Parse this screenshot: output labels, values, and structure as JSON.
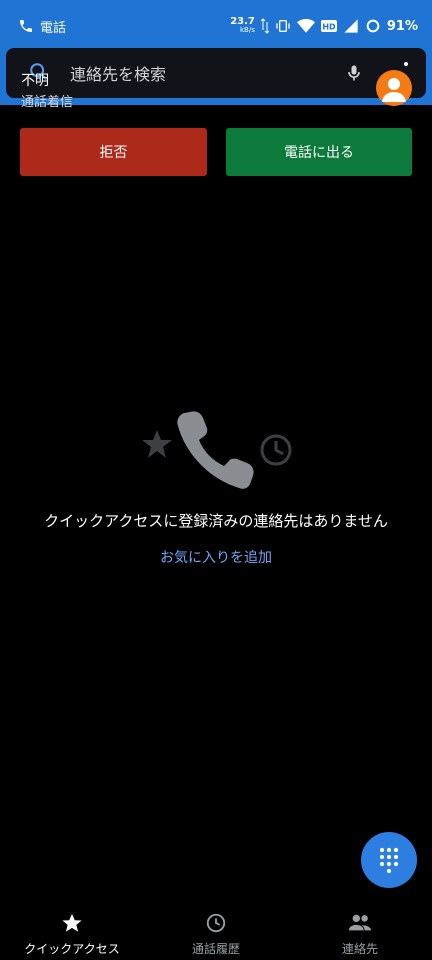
{
  "status_bar": {
    "app_label": "電話",
    "net_speed_value": "23.7",
    "net_speed_unit": "kB/s",
    "battery_percent": "91%"
  },
  "search": {
    "placeholder": "連絡先を検索"
  },
  "incoming_call": {
    "caller_name": "不明",
    "status_text": "通話着信",
    "decline_label": "拒否",
    "answer_label": "電話に出る"
  },
  "empty_state": {
    "message": "クイックアクセスに登録済みの連絡先はありません",
    "action_label": "お気に入りを追加"
  },
  "bottom_nav": {
    "items": [
      {
        "label": "クイックアクセス",
        "icon": "star-icon",
        "active": true
      },
      {
        "label": "通話履歴",
        "icon": "clock-icon",
        "active": false
      },
      {
        "label": "連絡先",
        "icon": "people-icon",
        "active": false
      }
    ]
  },
  "colors": {
    "status_blue": "#1f74d4",
    "decline_red": "#ad2a1a",
    "answer_green": "#0b7a3b",
    "fab_blue": "#2c7fe0",
    "avatar_orange": "#f57c14",
    "link_blue": "#6ea6f5"
  }
}
